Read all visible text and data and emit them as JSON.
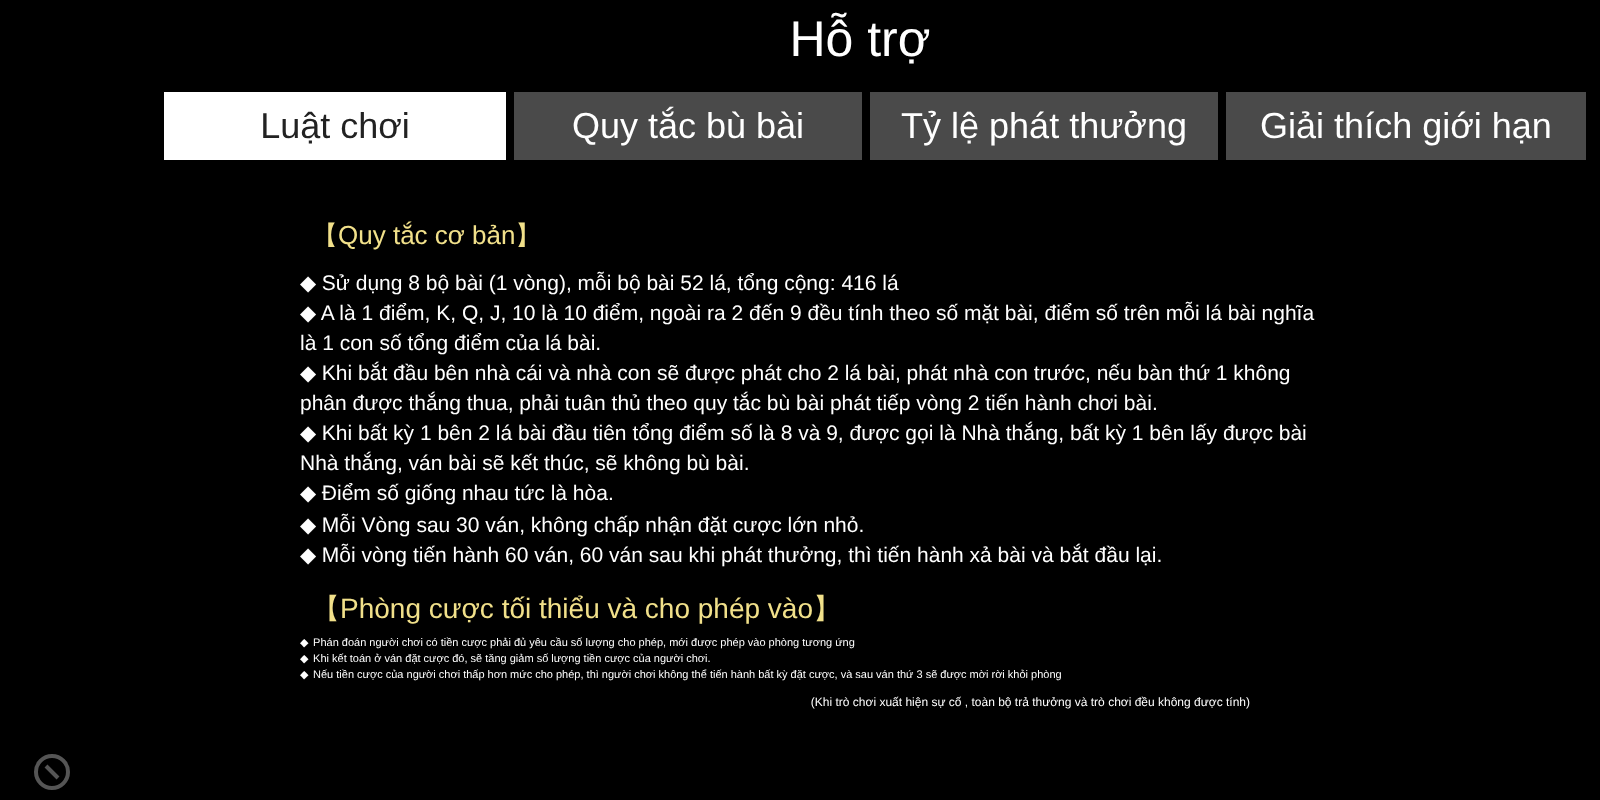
{
  "title": "Hỗ trợ",
  "tabs": [
    {
      "label": "Luật chơi",
      "selected": true
    },
    {
      "label": "Quy tắc bù bài",
      "selected": false
    },
    {
      "label": "Tỷ lệ phát thưởng",
      "selected": false
    },
    {
      "label": "Giải thích giới hạn",
      "selected": false
    }
  ],
  "sections": [
    {
      "heading": "【Quy tắc cơ bản】",
      "kind": "main",
      "items": [
        {
          "bullet": "◆",
          "text": "Sử dụng 8 bộ bài (1 vòng), mỗi bộ bài 52 lá, tổng cộng: 416 lá"
        },
        {
          "bullet": "◆",
          "text": "A là 1 điểm, K, Q, J, 10 là 10 điểm, ngoài ra 2 đến 9 đều tính theo số mặt bài, điểm số trên mỗi lá bài nghĩa là 1 con số tổng điểm của lá bài."
        },
        {
          "bullet": "◆",
          "text": "Khi bắt đầu bên nhà cái và nhà con sẽ được phát cho 2 lá bài, phát nhà con trước, nếu bàn thứ 1 không phân được thắng thua, phải tuân thủ theo quy tắc bù bài phát tiếp vòng 2 tiến hành chơi bài."
        },
        {
          "bullet": "◆",
          "text": "Khi bất kỳ 1 bên 2 lá bài đầu tiên tổng điểm số là 8 và 9, được gọi là Nhà thắng, bất kỳ 1 bên lấy được bài Nhà thắng, ván bài sẽ kết thúc, sẽ không bù bài."
        },
        {
          "bullet": "◆",
          "text": "Điểm số giống nhau tức là hòa."
        },
        {
          "bullet": "◆",
          "text": "Mỗi Vòng sau 30 ván, không chấp nhận đặt cược lớn nhỏ."
        },
        {
          "bullet": "◆",
          "text": "Mỗi vòng tiến hành 60 ván, 60 ván sau khi phát thưởng, thì tiến hành xả bài và bắt đầu lại."
        }
      ]
    },
    {
      "heading": "【Phòng cược tối thiểu và cho phép vào】",
      "kind": "fine",
      "items": [
        {
          "bullet": "◆",
          "text": "Phán đoán người chơi có tiền cược phải đủ yêu cầu số lượng cho phép, mới được phép vào phòng tương ứng"
        },
        {
          "bullet": "◆",
          "text": "Khi kết toán ở ván đặt cược đó, sẽ tăng giảm số lượng tiền cược của người chơi."
        },
        {
          "bullet": "◆",
          "text": "Nếu tiền cược của người chơi thấp hơn mức cho phép, thì người chơi không thể tiến hành bất kỳ đặt cược, và sau ván thứ 3 sẽ được mời rời khỏi phòng"
        }
      ]
    }
  ],
  "note": "(Khi trò chơi xuất hiện sự cố , toàn bộ trả thưởng và trò chơi đều không được tính)"
}
